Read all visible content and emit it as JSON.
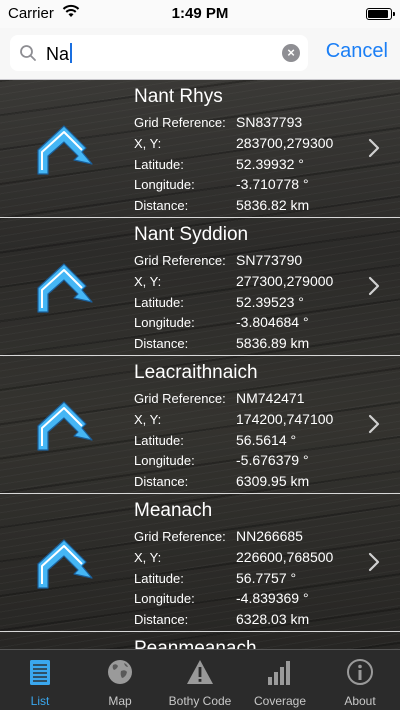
{
  "status_bar": {
    "carrier": "Carrier",
    "time": "1:49 PM"
  },
  "search": {
    "query": "Na",
    "cancel_label": "Cancel"
  },
  "labels": {
    "grid_reference": "Grid Reference:",
    "xy": "X, Y:",
    "latitude": "Latitude:",
    "longitude": "Longitude:",
    "distance": "Distance:"
  },
  "results": [
    {
      "name": "Nant Rhys",
      "grid_reference": "SN837793",
      "xy": "283700,279300",
      "latitude": "52.39932 °",
      "longitude": "-3.710778 °",
      "distance": "5836.82 km"
    },
    {
      "name": "Nant Syddion",
      "grid_reference": "SN773790",
      "xy": "277300,279000",
      "latitude": "52.39523 °",
      "longitude": "-3.804684 °",
      "distance": "5836.89 km"
    },
    {
      "name": "Leacraithnaich",
      "grid_reference": "NM742471",
      "xy": "174200,747100",
      "latitude": "56.5614 °",
      "longitude": "-5.676379 °",
      "distance": "6309.95 km"
    },
    {
      "name": "Meanach",
      "grid_reference": "NN266685",
      "xy": "226600,768500",
      "latitude": "56.7757 °",
      "longitude": "-4.839369 °",
      "distance": "6328.03 km"
    },
    {
      "name": "Peanmeanach"
    }
  ],
  "tabs": [
    {
      "label": "List",
      "icon": "list-icon",
      "active": true
    },
    {
      "label": "Map",
      "icon": "globe-icon",
      "active": false
    },
    {
      "label": "Bothy Code",
      "icon": "warning-icon",
      "active": false
    },
    {
      "label": "Coverage",
      "icon": "signal-bars-icon",
      "active": false
    },
    {
      "label": "About",
      "icon": "info-icon",
      "active": false
    }
  ],
  "colors": {
    "accent": "#1a7ef5",
    "tab_active": "#3aa7ee",
    "icon_blue": "#45b6f5"
  }
}
